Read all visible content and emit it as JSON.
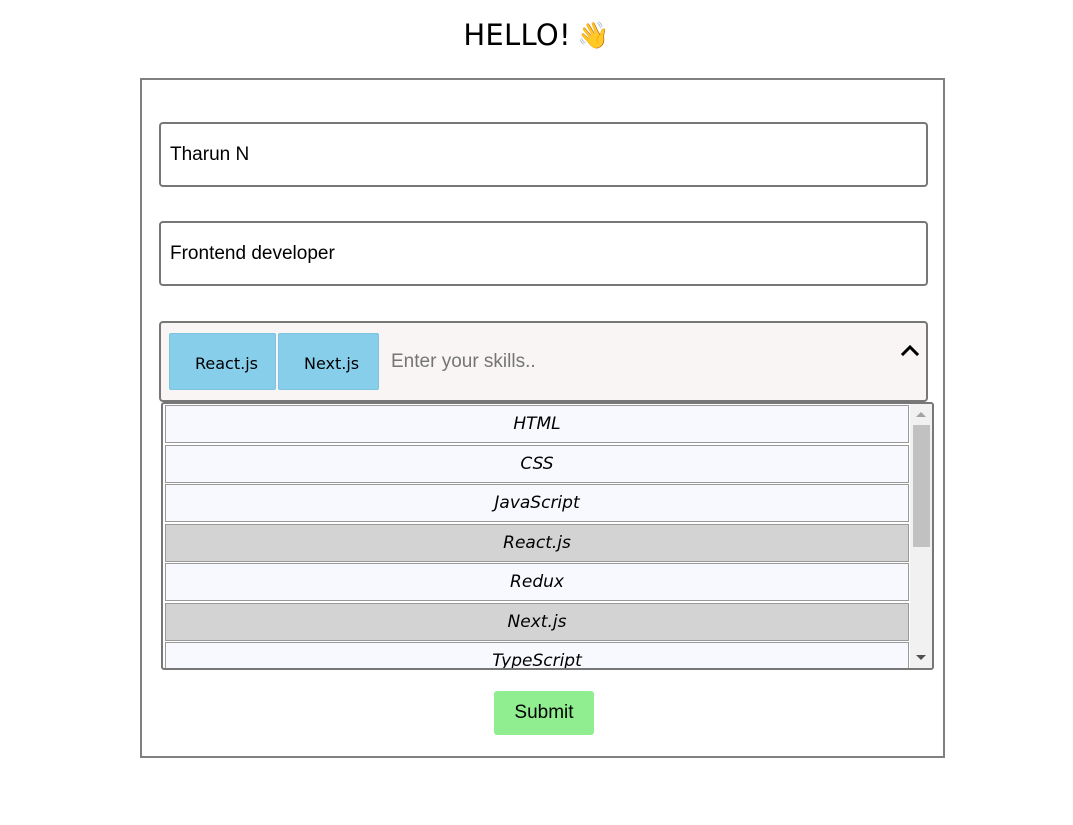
{
  "header": {
    "title": "HELLO!",
    "emoji": "👋"
  },
  "form": {
    "name_value": "Tharun N",
    "role_value": "Frontend developer",
    "skills": {
      "selected_chips": [
        {
          "label": "React.js",
          "remove_icon": "×"
        },
        {
          "label": "Next.js",
          "remove_icon": "×"
        }
      ],
      "input_placeholder": "Enter your skills..",
      "input_value": "",
      "dropdown_open": true,
      "options": [
        {
          "label": "HTML",
          "selected": false
        },
        {
          "label": "CSS",
          "selected": false
        },
        {
          "label": "JavaScript",
          "selected": false
        },
        {
          "label": "React.js",
          "selected": true
        },
        {
          "label": "Redux",
          "selected": false
        },
        {
          "label": "Next.js",
          "selected": true
        },
        {
          "label": "TypeScript",
          "selected": false
        }
      ],
      "scroll_position_fraction": 0
    },
    "submit_label": "Submit"
  },
  "colors": {
    "chip_bg": "#87ceeb",
    "selected_option_bg": "#d3d3d3",
    "option_bg": "#f8f9fe",
    "submit_bg": "#90ee90",
    "skills_box_bg": "#f8f5f4"
  },
  "icons": {
    "caret": "chevron-up-icon",
    "chip_remove": "close-icon",
    "scroll_up": "triangle-up-icon",
    "scroll_down": "triangle-down-icon"
  }
}
